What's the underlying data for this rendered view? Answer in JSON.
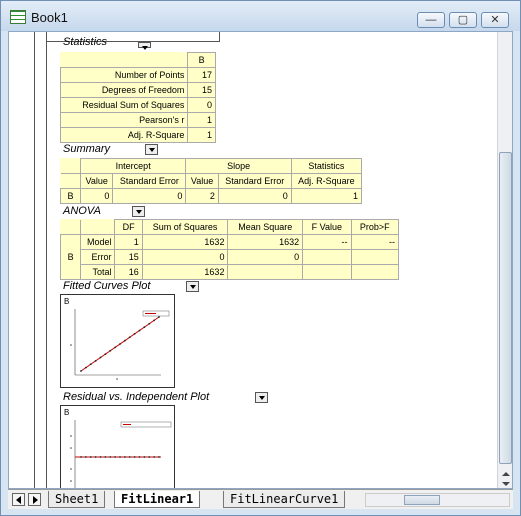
{
  "window": {
    "title": "Book1",
    "min": "—",
    "max": "▢",
    "close": "✕"
  },
  "sections": {
    "statistics": "Statistics",
    "summary": "Summary",
    "anova": "ANOVA",
    "fitted": "Fitted Curves Plot",
    "residual": "Residual vs. Independent Plot"
  },
  "stats": {
    "col": "B",
    "rows": [
      {
        "label": "Number of Points",
        "value": "17"
      },
      {
        "label": "Degrees of Freedom",
        "value": "15"
      },
      {
        "label": "Residual Sum of Squares",
        "value": "0"
      },
      {
        "label": "Pearson's r",
        "value": "1"
      },
      {
        "label": "Adj. R-Square",
        "value": "1"
      }
    ]
  },
  "summary": {
    "groups": [
      "Intercept",
      "Slope",
      "Statistics"
    ],
    "subs": [
      "Value",
      "Standard Error",
      "Value",
      "Standard Error",
      "Adj. R-Square"
    ],
    "row": {
      "label": "B",
      "cells": [
        "0",
        "0",
        "2",
        "0",
        "1"
      ]
    }
  },
  "anova": {
    "headers": [
      "DF",
      "Sum of Squares",
      "Mean Square",
      "F Value",
      "Prob>F"
    ],
    "rowlabel": "B",
    "rows": [
      {
        "name": "Model",
        "cells": [
          "1",
          "1632",
          "1632",
          "--",
          "--"
        ]
      },
      {
        "name": "Error",
        "cells": [
          "15",
          "0",
          "0",
          "",
          ""
        ]
      },
      {
        "name": "Total",
        "cells": [
          "16",
          "1632",
          "",
          "",
          ""
        ]
      }
    ]
  },
  "plots": {
    "fitted_label": "B",
    "residual_label": "B"
  },
  "tabs": {
    "sheet1": "Sheet1",
    "fitlinear1": "FitLinear1",
    "fitlinearcurve1": "FitLinearCurve1"
  },
  "colors": {
    "fit_line": "#cc0000",
    "cell_bg": "#ffffc7"
  }
}
